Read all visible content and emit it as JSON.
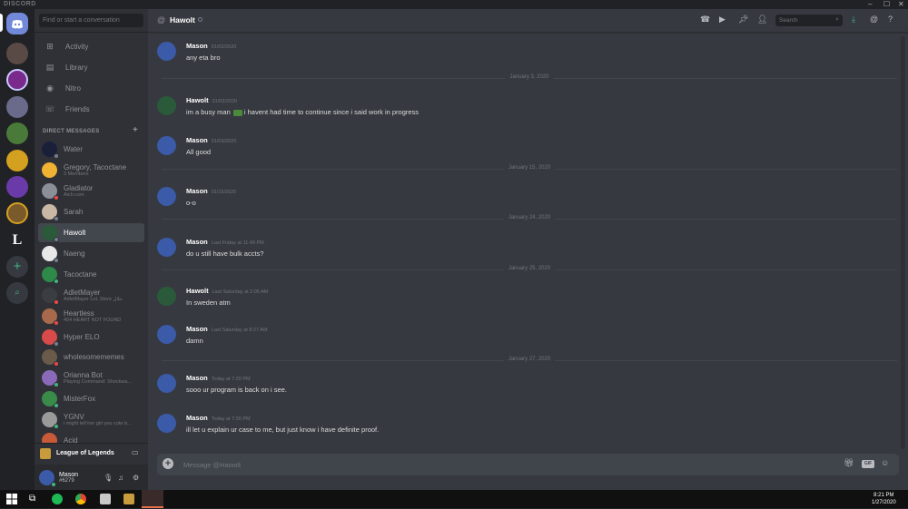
{
  "window": {
    "title": "DISCORD"
  },
  "sidebar": {
    "search_placeholder": "Find or start a conversation",
    "nav": [
      {
        "label": "Activity",
        "icon": "gamepad-icon"
      },
      {
        "label": "Library",
        "icon": "library-icon"
      },
      {
        "label": "Nitro",
        "icon": "nitro-icon"
      },
      {
        "label": "Friends",
        "icon": "friends-icon"
      }
    ],
    "dm_header": "DIRECT MESSAGES",
    "dms": [
      {
        "name": "Water",
        "sub": "",
        "color": "#1a1f3a",
        "status": "#747f8d"
      },
      {
        "name": "Gregory, Tacoctane",
        "sub": "3 Members",
        "color": "#f0b232",
        "status": ""
      },
      {
        "name": "Gladiator",
        "sub": "Aich.com",
        "color": "#8a8f98",
        "status": "#f04747"
      },
      {
        "name": "Sarah",
        "sub": "",
        "color": "#c9b8a6",
        "status": "#747f8d"
      },
      {
        "name": "Hawolt",
        "sub": "",
        "color": "#2a5a3a",
        "status": "#747f8d"
      },
      {
        "name": "Naeng",
        "sub": "",
        "color": "#e8e8e8",
        "status": "#747f8d"
      },
      {
        "name": "Tacoctane",
        "sub": "",
        "color": "#2f8a4a",
        "status": "#43b581"
      },
      {
        "name": "AdletMayer",
        "sub": "AdletMayer LoL Store حلال",
        "color": "#3a3d42",
        "status": "#f04747"
      },
      {
        "name": "Heartless",
        "sub": "404 HEART NOT FOUND",
        "color": "#a86a4a",
        "status": "#f04747"
      },
      {
        "name": "Hyper ELO",
        "sub": "",
        "color": "#d94a4a",
        "status": "#747f8d"
      },
      {
        "name": "wholesomememes",
        "sub": "",
        "color": "#6a5a4a",
        "status": "#f04747"
      },
      {
        "name": "Orianna Bot",
        "sub": "Playing Command: Shockwa...",
        "color": "#8a6ab8",
        "status": "#43b581"
      },
      {
        "name": "MisterFox",
        "sub": "",
        "color": "#3a8a4a",
        "status": "#43b581"
      },
      {
        "name": "YGNV",
        "sub": "i might tell her girl you cute b...",
        "color": "#9a9a9a",
        "status": "#43b581"
      },
      {
        "name": "Acid",
        "sub": "",
        "color": "#c85a3a",
        "status": ""
      }
    ],
    "guild_activity": "League of Legends",
    "user": {
      "name": "Mason",
      "tag": "#6279"
    }
  },
  "header": {
    "channel": "Hawolt",
    "search_placeholder": "Search"
  },
  "messages": [
    {
      "type": "msg",
      "author": "Mason",
      "ts": "01/02/2020",
      "text": "any eta bro",
      "avatar": "#3b5aa7"
    },
    {
      "type": "date",
      "label": "January 3, 2020"
    },
    {
      "type": "msg",
      "author": "Hawolt",
      "ts": "01/03/2020",
      "text": "im a busy man",
      "text2": " i havent had time to continue since i said work in progress",
      "avatar": "#2a5a3a"
    },
    {
      "type": "msg",
      "author": "Mason",
      "ts": "01/03/2020",
      "text": "All good",
      "avatar": "#3b5aa7"
    },
    {
      "type": "date",
      "label": "January 15, 2020"
    },
    {
      "type": "msg",
      "author": "Mason",
      "ts": "01/15/2020",
      "text": "o-o",
      "avatar": "#3b5aa7"
    },
    {
      "type": "date",
      "label": "January 24, 2020"
    },
    {
      "type": "msg",
      "author": "Mason",
      "ts": "Last Friday at 11:49 PM",
      "text": "do u still have bulk accts?",
      "avatar": "#3b5aa7"
    },
    {
      "type": "date",
      "label": "January 25, 2020"
    },
    {
      "type": "msg",
      "author": "Hawolt",
      "ts": "Last Saturday at 2:05 AM",
      "text": "In sweden atm",
      "avatar": "#2a5a3a"
    },
    {
      "type": "msg",
      "author": "Mason",
      "ts": "Last Saturday at 8:27 AM",
      "text": "damn",
      "avatar": "#3b5aa7"
    },
    {
      "type": "date",
      "label": "January 27, 2020"
    },
    {
      "type": "msg",
      "author": "Mason",
      "ts": "Today at 7:20 PM",
      "text": "sooo ur program is back on i see.",
      "avatar": "#3b5aa7"
    },
    {
      "type": "msg",
      "author": "Mason",
      "ts": "Today at 7:30 PM",
      "text": "ill let u explain ur case to me, but just know i have definite proof.",
      "avatar": "#3b5aa7"
    }
  ],
  "composer": {
    "placeholder": "Message @Hawolt",
    "gif_label": "GIF"
  },
  "taskbar": {
    "time": "8:21 PM",
    "date": "1/27/2020"
  }
}
